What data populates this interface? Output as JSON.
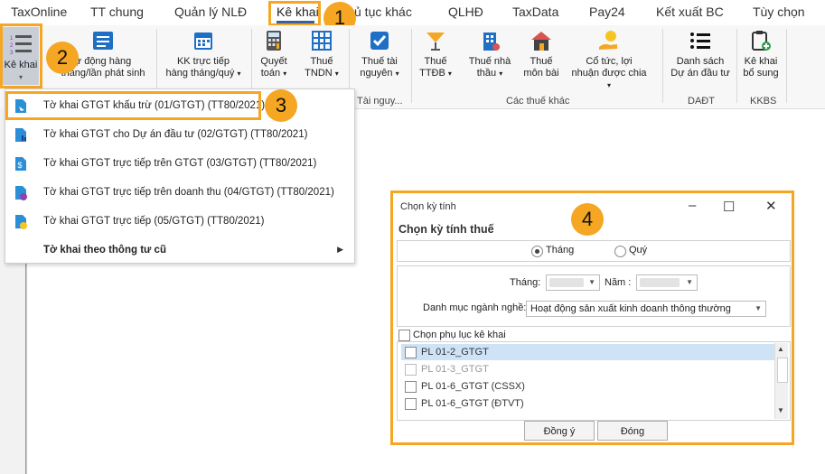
{
  "tabs": [
    "TaxOnline",
    "TT chung",
    "Quản lý NLĐ",
    "Kê khai",
    "ủ tục khác",
    "QLHĐ",
    "TaxData",
    "Pay24",
    "Kết xuất BC",
    "Tùy chọn"
  ],
  "active_tab": "Kê khai",
  "ribbon": {
    "ke_khai": "Kê khai",
    "tu_dong_1": "ự động hàng",
    "tu_dong_2": "tháng/lần phát sinh",
    "kk_truc_tiep_1": "KK trực tiếp",
    "kk_truc_tiep_2": "hàng tháng/quý",
    "quyet_toan_1": "Quyết",
    "quyet_toan_2": "toán",
    "thue_tndn_1": "Thuế",
    "thue_tndn_2": "TNDN",
    "thue_tn_1": "Thuế tài",
    "thue_tn_2": "nguyên",
    "thue_ttdb_1": "Thuế",
    "thue_ttdb_2": "TTĐB",
    "thue_nha_thau_1": "Thuế nhà",
    "thue_nha_thau_2": "thầu",
    "thue_mon_bai_1": "Thuế",
    "thue_mon_bai_2": "môn bài",
    "co_tuc_1": "Cổ tức, lợi",
    "co_tuc_2": "nhuận được chia",
    "danh_sach_1": "Danh sách",
    "danh_sach_2": "Dự án đầu tư",
    "ke_khai_bs_1": "Kê khai",
    "ke_khai_bs_2": "bổ sung",
    "group_tai_nguyen": "Tài nguy...",
    "group_cac_thue_khac": "Các thuế khác",
    "group_daadt": "DAĐT",
    "group_kkbs": "KKBS"
  },
  "menu": {
    "items": [
      "Tờ khai GTGT khấu trừ (01/GTGT) (TT80/2021)",
      "Tờ khai GTGT cho Dự án đầu tư (02/GTGT) (TT80/2021)",
      "Tờ khai GTGT trực tiếp trên GTGT (03/GTGT) (TT80/2021)",
      "Tờ khai GTGT trực tiếp trên doanh thu (04/GTGT) (TT80/2021)",
      "Tờ khai GTGT trực tiếp (05/GTGT) (TT80/2021)"
    ],
    "old_circular": "Tờ khai theo thông tư cũ"
  },
  "badges": [
    "1",
    "2",
    "3",
    "4"
  ],
  "dialog": {
    "window_title": "Chọn kỳ tính",
    "heading": "Chọn kỳ tính thuế",
    "radio_month": "Tháng",
    "radio_quarter": "Quý",
    "month_label": "Tháng:",
    "year_label": "Năm :",
    "industry_label": "Danh mục ngành nghề:",
    "industry_value": "Hoạt động sản xuất kinh doanh thông thường",
    "appendix_label": "Chọn phụ lục kê khai",
    "appendix_items": [
      "PL 01-2_GTGT",
      "PL 01-3_GTGT",
      "PL 01-6_GTGT (CSSX)",
      "PL 01-6_GTGT (ĐTVT)"
    ],
    "btn_ok": "Đồng ý",
    "btn_close": "Đóng"
  },
  "colors": {
    "highlight": "#f5a623",
    "active_underline": "#3a5f9e",
    "selected_row": "#cfe3f7"
  }
}
